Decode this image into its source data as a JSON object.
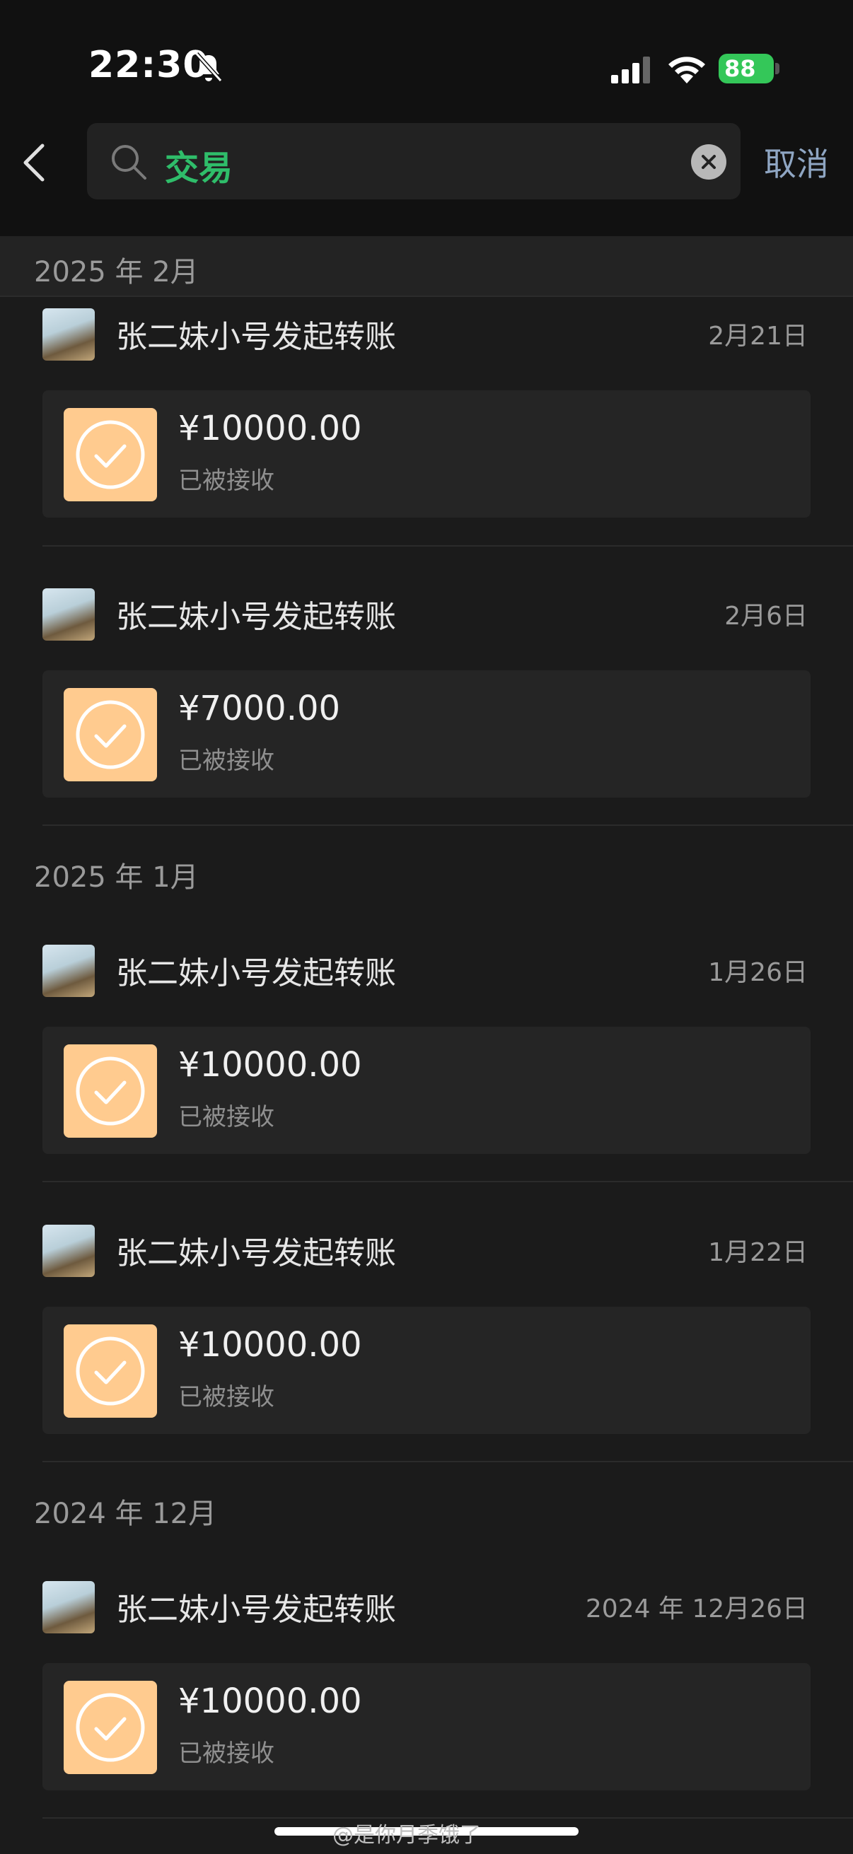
{
  "status_bar": {
    "time": "22:30",
    "battery": "88"
  },
  "search": {
    "query": "交易",
    "cancel_label": "取消"
  },
  "sections": [
    {
      "header": "2025 年 2月",
      "items": [
        {
          "title": "张二妹小号发起转账",
          "date": "2月21日",
          "amount": "¥10000.00",
          "status": "已被接收"
        },
        {
          "title": "张二妹小号发起转账",
          "date": "2月6日",
          "amount": "¥7000.00",
          "status": "已被接收"
        }
      ]
    },
    {
      "header": "2025 年 1月",
      "items": [
        {
          "title": "张二妹小号发起转账",
          "date": "1月26日",
          "amount": "¥10000.00",
          "status": "已被接收"
        },
        {
          "title": "张二妹小号发起转账",
          "date": "1月22日",
          "amount": "¥10000.00",
          "status": "已被接收"
        }
      ]
    },
    {
      "header": "2024 年 12月",
      "items": [
        {
          "title": "张二妹小号发起转账",
          "date": "2024 年 12月26日",
          "amount": "¥10000.00",
          "status": "已被接收"
        }
      ]
    }
  ],
  "watermark": "@是你月季饿了",
  "colors": {
    "accent_green": "#2fbd6a",
    "transfer_orange": "#ffcb8f",
    "cancel_blue": "#8fa6c3"
  }
}
